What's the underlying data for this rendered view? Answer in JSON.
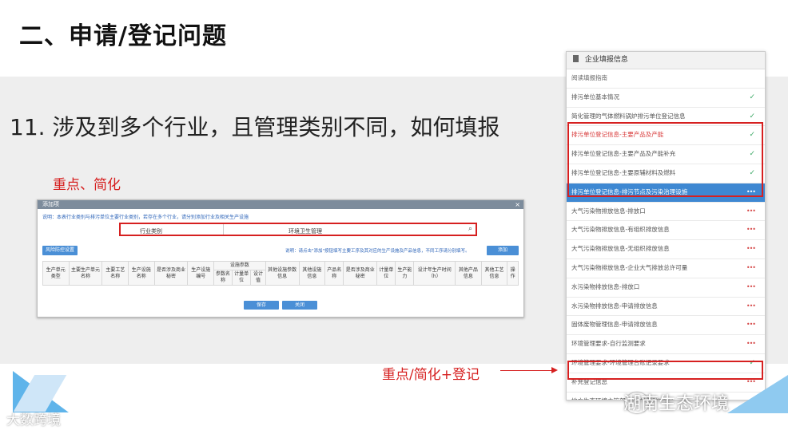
{
  "slide": {
    "title": "二、申请/登记问题",
    "question": "11. 涉及到多个行业，且管理类别不同，如何填报",
    "label_key": "重点、简化",
    "label_supplement": "重点/简化+登记"
  },
  "dialog": {
    "title": "添加项",
    "close": "×",
    "note": "说明：本表行业类别与排污单位主要行业类别，若存在多个行业，请分别添加行业及相关生产设施",
    "industry_label": "行业类别",
    "industry_value": "环境卫生管理",
    "btn_settings": "风险防控设置",
    "note2": "说明：请点击\"添加\"按钮填写主要工序及其对应的生产设施及产品信息，不同工序请分别填写。",
    "btn_add": "添加",
    "columns": [
      "生产单元类型",
      "主要生产单元名称",
      "主要工艺名称",
      "生产设施名称",
      "是否涉及商业秘密",
      "生产设施编号",
      "参数名称",
      "计量单位",
      "设计值",
      "其他设施参数信息",
      "其他设施信息",
      "产品名称",
      "是否涉及商业秘密",
      "计量单位",
      "生产能力",
      "设计年生产时间（h）",
      "其他产品信息",
      "其他工艺信息",
      "操作"
    ],
    "group_header": "设施参数",
    "btn_save": "保存",
    "btn_close": "关闭"
  },
  "sidebar": {
    "title": "企业填报信息",
    "items": [
      {
        "label": "阅读填报指南",
        "status": "none",
        "style": "guide"
      },
      {
        "label": "排污单位基本情况",
        "status": "ok",
        "style": "normal"
      },
      {
        "label": "简化管理的气体燃料锅炉排污单位登记信息",
        "status": "ok",
        "style": "normal"
      },
      {
        "label": "排污单位登记信息-主要产品及产能",
        "status": "ok",
        "style": "red"
      },
      {
        "label": "排污单位登记信息-主要产品及产能补充",
        "status": "ok",
        "style": "normal"
      },
      {
        "label": "排污单位登记信息-主要原辅材料及燃料",
        "status": "ok",
        "style": "normal"
      },
      {
        "label": "排污单位登记信息-排污节点及污染治理设施",
        "status": "dots",
        "style": "active"
      },
      {
        "label": "大气污染物排放信息-排放口",
        "status": "dots",
        "style": "normal"
      },
      {
        "label": "大气污染物排放信息-有组织排放信息",
        "status": "dots",
        "style": "normal"
      },
      {
        "label": "大气污染物排放信息-无组织排放信息",
        "status": "dots",
        "style": "normal"
      },
      {
        "label": "大气污染物排放信息-企业大气排放总许可量",
        "status": "dots",
        "style": "normal"
      },
      {
        "label": "水污染物排放信息-排放口",
        "status": "dots",
        "style": "normal"
      },
      {
        "label": "水污染物排放信息-申请排放信息",
        "status": "dots",
        "style": "normal"
      },
      {
        "label": "固体废物管理信息-申请排放信息",
        "status": "dots",
        "style": "normal"
      },
      {
        "label": "环境管理要求-自行监测要求",
        "status": "dots",
        "style": "normal"
      },
      {
        "label": "环境管理要求-环境管理台账记录要求",
        "status": "ok",
        "style": "normal"
      },
      {
        "label": "补充登记信息",
        "status": "dots",
        "style": "normal"
      },
      {
        "label": "地方生态环境主管部门依法增加的内容",
        "status": "none",
        "style": "normal"
      }
    ]
  },
  "watermark": {
    "left": "大数跨境",
    "right": "湖南生态环境"
  },
  "status_icons": {
    "ok": "✓",
    "dots": "•••"
  }
}
